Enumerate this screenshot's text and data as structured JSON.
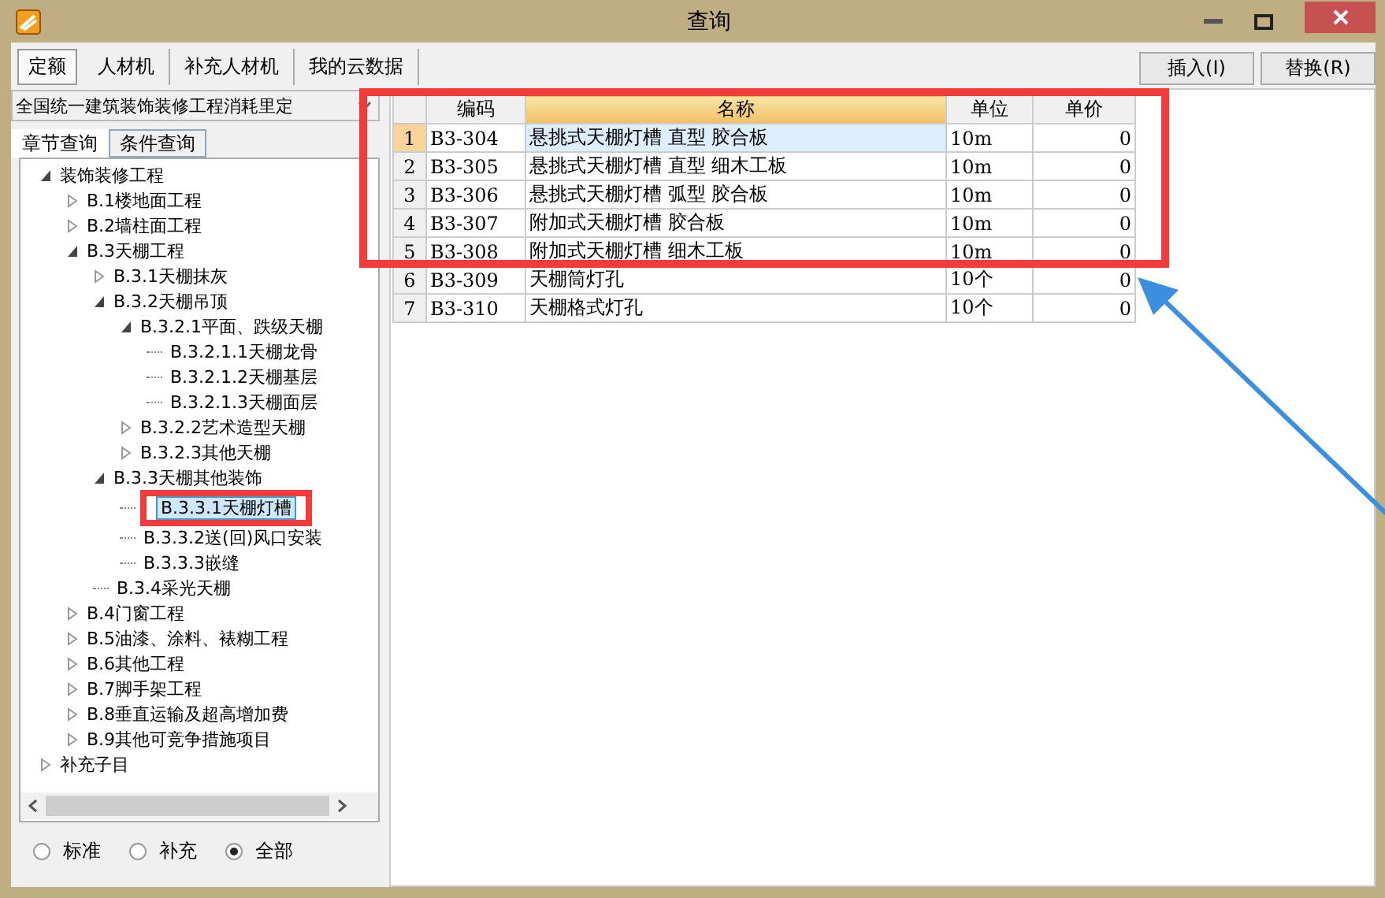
{
  "window": {
    "title": "查询"
  },
  "tabs": [
    {
      "label": "定额",
      "selected": true
    },
    {
      "label": "人材机",
      "selected": false
    },
    {
      "label": "补充人材机",
      "selected": false
    },
    {
      "label": "我的云数据",
      "selected": false
    }
  ],
  "buttons": [
    "插入(I)",
    "替换(R)"
  ],
  "library_select": {
    "value": "全国统一建筑装饰装修工程消耗里定"
  },
  "query_tabs": [
    {
      "label": "章节查询",
      "selected": true
    },
    {
      "label": "条件查询",
      "selected": false
    }
  ],
  "tree": [
    {
      "label": "装饰装修工程",
      "expanded": true,
      "children": [
        {
          "label": "B.1楼地面工程",
          "expanded": false
        },
        {
          "label": "B.2墙柱面工程",
          "expanded": false
        },
        {
          "label": "B.3天棚工程",
          "expanded": true,
          "children": [
            {
              "label": "B.3.1天棚抹灰",
              "expanded": false
            },
            {
              "label": "B.3.2天棚吊顶",
              "expanded": true,
              "children": [
                {
                  "label": "B.3.2.1平面、跌级天棚",
                  "expanded": true,
                  "children": [
                    {
                      "label": "B.3.2.1.1天棚龙骨",
                      "selected": false
                    },
                    {
                      "label": "B.3.2.1.2天棚基层",
                      "selected": false
                    },
                    {
                      "label": "B.3.2.1.3天棚面层",
                      "selected": false
                    }
                  ]
                },
                {
                  "label": "B.3.2.2艺术造型天棚",
                  "expanded": false
                },
                {
                  "label": "B.3.2.3其他天棚",
                  "expanded": false
                }
              ]
            },
            {
              "label": "B.3.3天棚其他装饰",
              "expanded": true,
              "children": [
                {
                  "label": "B.3.3.1天棚灯槽",
                  "selected": true
                },
                {
                  "label": "B.3.3.2送(回)风口安装",
                  "selected": false
                },
                {
                  "label": "B.3.3.3嵌缝",
                  "selected": false
                }
              ]
            },
            {
              "label": "B.3.4采光天棚",
              "selected": false
            }
          ]
        },
        {
          "label": "B.4门窗工程",
          "expanded": false
        },
        {
          "label": "B.5油漆、涂料、裱糊工程",
          "expanded": false
        },
        {
          "label": "B.6其他工程",
          "expanded": false
        },
        {
          "label": "B.7脚手架工程",
          "expanded": false
        },
        {
          "label": "B.8垂直运输及超高增加费",
          "expanded": false
        },
        {
          "label": "B.9其他可竞争措施项目",
          "expanded": false
        }
      ]
    },
    {
      "label": "补充子目",
      "expanded": false
    }
  ],
  "filter": [
    {
      "label": "标准",
      "selected": false
    },
    {
      "label": "补充",
      "selected": false
    },
    {
      "label": "全部",
      "selected": true
    }
  ],
  "table": {
    "columns": [
      "编码",
      "名称",
      "单位",
      "单价"
    ],
    "rows": [
      {
        "index": "1",
        "code": "B3-304",
        "name": "悬挑式天棚灯槽 直型 胶合板",
        "unit": "10m",
        "price": "0",
        "selected": true
      },
      {
        "index": "2",
        "code": "B3-305",
        "name": "悬挑式天棚灯槽 直型 细木工板",
        "unit": "10m",
        "price": "0",
        "selected": false
      },
      {
        "index": "3",
        "code": "B3-306",
        "name": "悬挑式天棚灯槽 弧型 胶合板",
        "unit": "10m",
        "price": "0",
        "selected": false
      },
      {
        "index": "4",
        "code": "B3-307",
        "name": "附加式天棚灯槽 胶合板",
        "unit": "10m",
        "price": "0",
        "selected": false
      },
      {
        "index": "5",
        "code": "B3-308",
        "name": "附加式天棚灯槽 细木工板",
        "unit": "10m",
        "price": "0",
        "selected": false
      },
      {
        "index": "6",
        "code": "B3-309",
        "name": "天棚筒灯孔",
        "unit": "10个",
        "price": "0",
        "selected": false
      },
      {
        "index": "7",
        "code": "B3-310",
        "name": "天棚格式灯孔",
        "unit": "10个",
        "price": "0",
        "selected": false
      }
    ]
  }
}
